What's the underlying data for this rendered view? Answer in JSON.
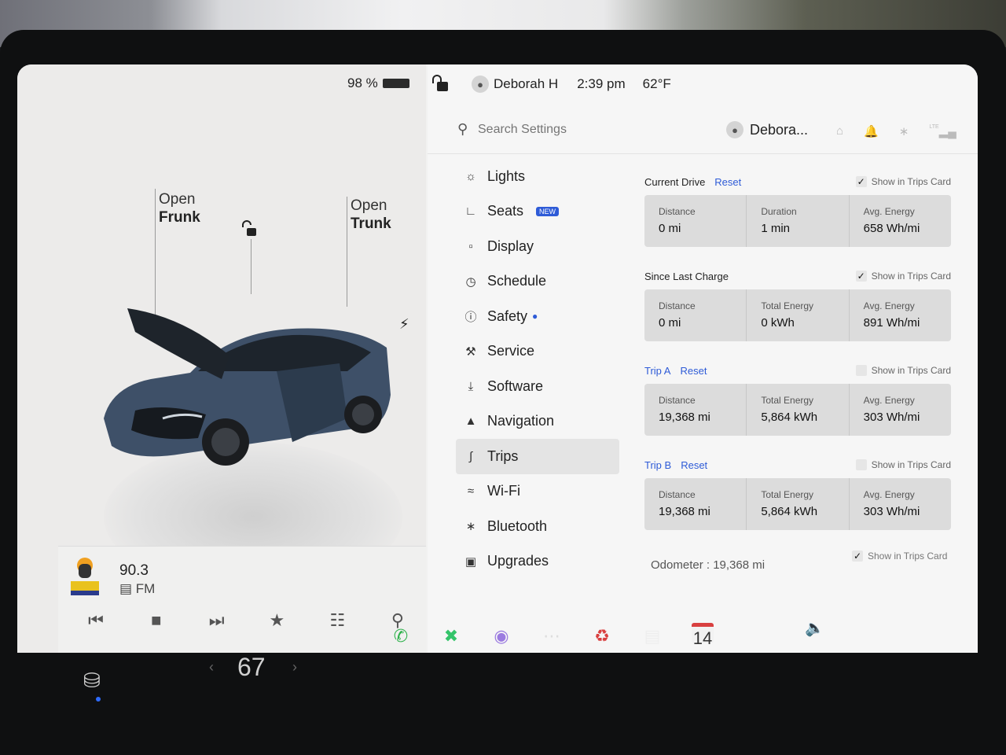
{
  "status_bar": {
    "battery_percent": "98 %",
    "user_name": "Deborah H",
    "time": "2:39 pm",
    "temperature": "62°F"
  },
  "car_panel": {
    "frunk": {
      "line1": "Open",
      "line2": "Frunk"
    },
    "trunk": {
      "line1": "Open",
      "line2": "Trunk"
    },
    "charge_icon": "lightning-icon"
  },
  "media": {
    "frequency": "90.3",
    "band": "FM",
    "controls": [
      "previous-icon",
      "stop-icon",
      "next-icon",
      "favorite-icon",
      "equalizer-icon",
      "search-icon"
    ]
  },
  "settings_header": {
    "search_placeholder": "Search Settings",
    "profile_name": "Debora...",
    "icons": [
      "home-icon",
      "bell-icon",
      "bluetooth-icon",
      "signal-icon"
    ],
    "signal_label": "LTE"
  },
  "menu": {
    "items": [
      {
        "label": "Lights",
        "icon": "light-icon"
      },
      {
        "label": "Seats",
        "icon": "seat-icon",
        "badge": "NEW"
      },
      {
        "label": "Display",
        "icon": "display-icon"
      },
      {
        "label": "Schedule",
        "icon": "clock-icon"
      },
      {
        "label": "Safety",
        "icon": "safety-icon"
      },
      {
        "label": "Service",
        "icon": "wrench-icon"
      },
      {
        "label": "Software",
        "icon": "download-icon"
      },
      {
        "label": "Navigation",
        "icon": "navigation-icon"
      },
      {
        "label": "Trips",
        "icon": "trips-icon"
      },
      {
        "label": "Wi-Fi",
        "icon": "wifi-icon"
      },
      {
        "label": "Bluetooth",
        "icon": "bluetooth-icon"
      },
      {
        "label": "Upgrades",
        "icon": "lock-icon"
      }
    ],
    "active": "Trips"
  },
  "trips": {
    "show_label": "Show in Trips Card",
    "reset_label": "Reset",
    "current_drive": {
      "title": "Current Drive",
      "checked": true,
      "cells": [
        {
          "key": "Distance",
          "value": "0 mi"
        },
        {
          "key": "Duration",
          "value": "1 min"
        },
        {
          "key": "Avg. Energy",
          "value": "658 Wh/mi"
        }
      ]
    },
    "since_last_charge": {
      "title": "Since Last Charge",
      "checked": true,
      "cells": [
        {
          "key": "Distance",
          "value": "0 mi"
        },
        {
          "key": "Total Energy",
          "value": "0 kWh"
        },
        {
          "key": "Avg. Energy",
          "value": "891 Wh/mi"
        }
      ]
    },
    "trip_a": {
      "title": "Trip A",
      "checked": false,
      "cells": [
        {
          "key": "Distance",
          "value": "19,368 mi"
        },
        {
          "key": "Total Energy",
          "value": "5,864 kWh"
        },
        {
          "key": "Avg. Energy",
          "value": "303 Wh/mi"
        }
      ]
    },
    "trip_b": {
      "title": "Trip B",
      "checked": false,
      "cells": [
        {
          "key": "Distance",
          "value": "19,368 mi"
        },
        {
          "key": "Total Energy",
          "value": "5,864 kWh"
        },
        {
          "key": "Avg. Energy",
          "value": "303 Wh/mi"
        }
      ]
    },
    "odometer": "Odometer : 19,368 mi",
    "odometer_checked": true
  },
  "dock": {
    "cabin_temp": "67",
    "calendar_day": "14",
    "icons": [
      "car-icon",
      "phone-icon",
      "toybox-icon",
      "camera-icon",
      "more-icon",
      "joystick-icon",
      "notes-icon",
      "calendar-icon",
      "volume-icon"
    ]
  },
  "colors": {
    "accent": "#2e5bd7",
    "screen_bg": "#f6f6f6",
    "card_bg": "#dcdcdc",
    "phone_green": "#2fb24c",
    "toybox_green": "#34c46a"
  }
}
